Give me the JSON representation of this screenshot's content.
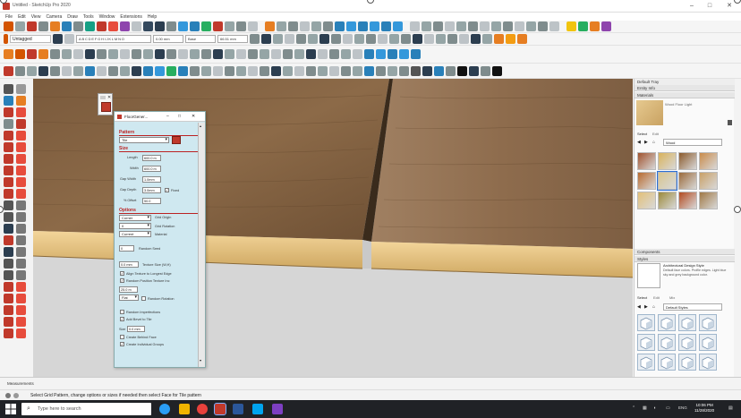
{
  "window": {
    "title": "Untitled - SketchUp Pro 2020",
    "minimize_icon": "minimize-icon",
    "maximize_icon": "maximize-icon",
    "close_icon": "close-icon"
  },
  "menu": [
    "File",
    "Edit",
    "View",
    "Camera",
    "Draw",
    "Tools",
    "Window",
    "Extensions",
    "Help"
  ],
  "toolbar": {
    "tag_dropdown": "Untagged",
    "field_tokens": [
      "A",
      "B",
      "C",
      "D",
      "E",
      "F",
      "G",
      "H",
      "I",
      "J",
      "K",
      "L",
      "M",
      "N",
      "O"
    ],
    "dim_field_1": "0.00 mm",
    "dim_field_2": "Base",
    "dim_field_3": "66.51 mm"
  },
  "tray": {
    "default_tray": "Default Tray",
    "entity_info": "Entity Info",
    "materials": "Materials",
    "material_name": "Wood Floor Light",
    "tab_select": "Select",
    "tab_edit": "Edit",
    "material_dropdown": "Wood",
    "components": "Components",
    "styles": "Styles",
    "style_name": "Architectural Design Style",
    "style_desc": "Default face colors. Profile edges. Light blue sky and grey background color.",
    "styles_tab_select": "Select",
    "styles_tab_edit": "Edit",
    "styles_tab_mix": "Mix",
    "styles_dropdown": "Default Styles",
    "swatch_colors": [
      "#a0522d",
      "#d9b25a",
      "#8b5a2b",
      "#c98b4a",
      "#b86a2e",
      "#d8c58f",
      "#9b6a3a",
      "#c9a066",
      "#e3c078",
      "#9c8a3a",
      "#b34a1f",
      "#a07844"
    ]
  },
  "dialog": {
    "title": "FloorGener...",
    "pattern_section": "Pattern",
    "pattern_value": "Tile",
    "size_section": "Size",
    "length_label": "Length",
    "length_value": "600.0 m",
    "width_label": "Width",
    "width_value": "600.0 m",
    "gapwidth_label": "Gap Width",
    "gapwidth_value": "1.0mm",
    "gapdepth_label": "Gap Depth",
    "gapdepth_value": "3.0mm",
    "fixed_label": "Fixed",
    "offset_label": "% Offset",
    "offset_value": "50.0",
    "options_section": "Options",
    "grid_origin_value": "Corner",
    "grid_origin_label": "Grid Origin",
    "grid_rotation_value": "0",
    "grid_rotation_label": "Grid Rotation",
    "material_value": "Current",
    "material_label": "Material",
    "seed_value": "0",
    "seed_label": "Random Seed",
    "texture_size_value": "0.0 mm",
    "texture_size_label": "Texture Size (W,H)",
    "align_texture_label": "Align Texture to Longest Edge",
    "random_position_label": "Random Position Texture Inc",
    "rotation_value": "25.0 m",
    "flat_value": "Flat",
    "random_rotation_label": "Random Rotation",
    "random_imperfections_label": "Random Imperfections",
    "add_bevel_label": "Add Bevel to Tile",
    "size_label": "Size",
    "size_value": "0.0 mm",
    "create_behind_label": "Create Behind Face",
    "create_groups_label": "Create Individual Groups"
  },
  "measurements_label": "Measurements",
  "status_text": "Select Grid Pattern, change options or sizes if needed then select Face for Tile pattern",
  "taskbar": {
    "search_placeholder": "Type here to search",
    "time": "10:06 PM",
    "date": "11/28/2020",
    "lang": "ENG"
  }
}
